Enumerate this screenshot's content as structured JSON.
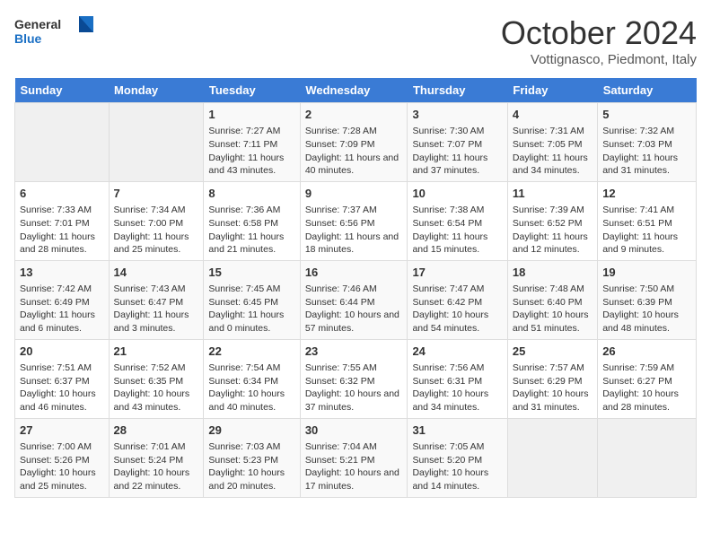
{
  "header": {
    "logo_general": "General",
    "logo_blue": "Blue",
    "month_title": "October 2024",
    "location": "Vottignasco, Piedmont, Italy"
  },
  "columns": [
    "Sunday",
    "Monday",
    "Tuesday",
    "Wednesday",
    "Thursday",
    "Friday",
    "Saturday"
  ],
  "weeks": [
    [
      {
        "day": "",
        "info": ""
      },
      {
        "day": "",
        "info": ""
      },
      {
        "day": "1",
        "info": "Sunrise: 7:27 AM\nSunset: 7:11 PM\nDaylight: 11 hours and 43 minutes."
      },
      {
        "day": "2",
        "info": "Sunrise: 7:28 AM\nSunset: 7:09 PM\nDaylight: 11 hours and 40 minutes."
      },
      {
        "day": "3",
        "info": "Sunrise: 7:30 AM\nSunset: 7:07 PM\nDaylight: 11 hours and 37 minutes."
      },
      {
        "day": "4",
        "info": "Sunrise: 7:31 AM\nSunset: 7:05 PM\nDaylight: 11 hours and 34 minutes."
      },
      {
        "day": "5",
        "info": "Sunrise: 7:32 AM\nSunset: 7:03 PM\nDaylight: 11 hours and 31 minutes."
      }
    ],
    [
      {
        "day": "6",
        "info": "Sunrise: 7:33 AM\nSunset: 7:01 PM\nDaylight: 11 hours and 28 minutes."
      },
      {
        "day": "7",
        "info": "Sunrise: 7:34 AM\nSunset: 7:00 PM\nDaylight: 11 hours and 25 minutes."
      },
      {
        "day": "8",
        "info": "Sunrise: 7:36 AM\nSunset: 6:58 PM\nDaylight: 11 hours and 21 minutes."
      },
      {
        "day": "9",
        "info": "Sunrise: 7:37 AM\nSunset: 6:56 PM\nDaylight: 11 hours and 18 minutes."
      },
      {
        "day": "10",
        "info": "Sunrise: 7:38 AM\nSunset: 6:54 PM\nDaylight: 11 hours and 15 minutes."
      },
      {
        "day": "11",
        "info": "Sunrise: 7:39 AM\nSunset: 6:52 PM\nDaylight: 11 hours and 12 minutes."
      },
      {
        "day": "12",
        "info": "Sunrise: 7:41 AM\nSunset: 6:51 PM\nDaylight: 11 hours and 9 minutes."
      }
    ],
    [
      {
        "day": "13",
        "info": "Sunrise: 7:42 AM\nSunset: 6:49 PM\nDaylight: 11 hours and 6 minutes."
      },
      {
        "day": "14",
        "info": "Sunrise: 7:43 AM\nSunset: 6:47 PM\nDaylight: 11 hours and 3 minutes."
      },
      {
        "day": "15",
        "info": "Sunrise: 7:45 AM\nSunset: 6:45 PM\nDaylight: 11 hours and 0 minutes."
      },
      {
        "day": "16",
        "info": "Sunrise: 7:46 AM\nSunset: 6:44 PM\nDaylight: 10 hours and 57 minutes."
      },
      {
        "day": "17",
        "info": "Sunrise: 7:47 AM\nSunset: 6:42 PM\nDaylight: 10 hours and 54 minutes."
      },
      {
        "day": "18",
        "info": "Sunrise: 7:48 AM\nSunset: 6:40 PM\nDaylight: 10 hours and 51 minutes."
      },
      {
        "day": "19",
        "info": "Sunrise: 7:50 AM\nSunset: 6:39 PM\nDaylight: 10 hours and 48 minutes."
      }
    ],
    [
      {
        "day": "20",
        "info": "Sunrise: 7:51 AM\nSunset: 6:37 PM\nDaylight: 10 hours and 46 minutes."
      },
      {
        "day": "21",
        "info": "Sunrise: 7:52 AM\nSunset: 6:35 PM\nDaylight: 10 hours and 43 minutes."
      },
      {
        "day": "22",
        "info": "Sunrise: 7:54 AM\nSunset: 6:34 PM\nDaylight: 10 hours and 40 minutes."
      },
      {
        "day": "23",
        "info": "Sunrise: 7:55 AM\nSunset: 6:32 PM\nDaylight: 10 hours and 37 minutes."
      },
      {
        "day": "24",
        "info": "Sunrise: 7:56 AM\nSunset: 6:31 PM\nDaylight: 10 hours and 34 minutes."
      },
      {
        "day": "25",
        "info": "Sunrise: 7:57 AM\nSunset: 6:29 PM\nDaylight: 10 hours and 31 minutes."
      },
      {
        "day": "26",
        "info": "Sunrise: 7:59 AM\nSunset: 6:27 PM\nDaylight: 10 hours and 28 minutes."
      }
    ],
    [
      {
        "day": "27",
        "info": "Sunrise: 7:00 AM\nSunset: 5:26 PM\nDaylight: 10 hours and 25 minutes."
      },
      {
        "day": "28",
        "info": "Sunrise: 7:01 AM\nSunset: 5:24 PM\nDaylight: 10 hours and 22 minutes."
      },
      {
        "day": "29",
        "info": "Sunrise: 7:03 AM\nSunset: 5:23 PM\nDaylight: 10 hours and 20 minutes."
      },
      {
        "day": "30",
        "info": "Sunrise: 7:04 AM\nSunset: 5:21 PM\nDaylight: 10 hours and 17 minutes."
      },
      {
        "day": "31",
        "info": "Sunrise: 7:05 AM\nSunset: 5:20 PM\nDaylight: 10 hours and 14 minutes."
      },
      {
        "day": "",
        "info": ""
      },
      {
        "day": "",
        "info": ""
      }
    ]
  ]
}
